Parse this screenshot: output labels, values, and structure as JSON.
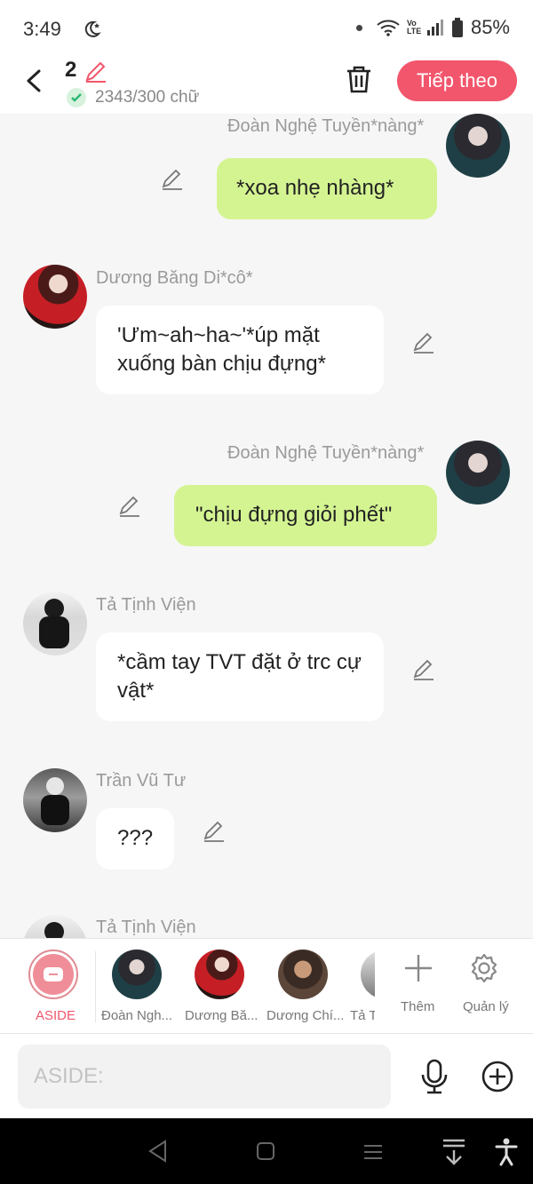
{
  "status": {
    "time": "3:49",
    "battery": "85%",
    "vo_lte": "Vo LTE"
  },
  "header": {
    "count": "2",
    "words": "2343/300 chữ",
    "next_label": "Tiếp theo"
  },
  "messages": [
    {
      "name": "Đoàn Nghệ Tuyền*nàng*",
      "text": "*xoa nhẹ nhàng*",
      "side": "me"
    },
    {
      "name": "Dương Băng Di*cô*",
      "text": "'Ưm~ah~ha~'*úp mặt xuống bàn chịu đựng*",
      "side": "other"
    },
    {
      "name": "Đoàn Nghệ Tuyền*nàng*",
      "text": "\"chịu đựng giỏi phết\"",
      "side": "me"
    },
    {
      "name": "Tả Tịnh Viện",
      "text": "*cầm tay TVT đặt ở trc cự vật*",
      "side": "other"
    },
    {
      "name": "Trần Vũ Tư",
      "text": "???",
      "side": "other"
    },
    {
      "name": "Tả Tịnh Viện",
      "text": "",
      "side": "other"
    }
  ],
  "cast": {
    "aside": "ASIDE",
    "members": [
      "Đoàn Ngh...",
      "Dương Bă...",
      "Dương Chí...",
      "Tả T"
    ],
    "add": "Thêm",
    "manage": "Quản lý"
  },
  "input": {
    "placeholder": "ASIDE:"
  },
  "colors": {
    "accent": "#f2566c",
    "me_bubble": "#d4f492",
    "other_bubble": "#ffffff"
  },
  "icons": [
    "back-icon",
    "pencil-icon",
    "check-icon",
    "trash-icon",
    "plus-icon",
    "gear-icon",
    "mic-icon",
    "plus-circle-icon"
  ]
}
